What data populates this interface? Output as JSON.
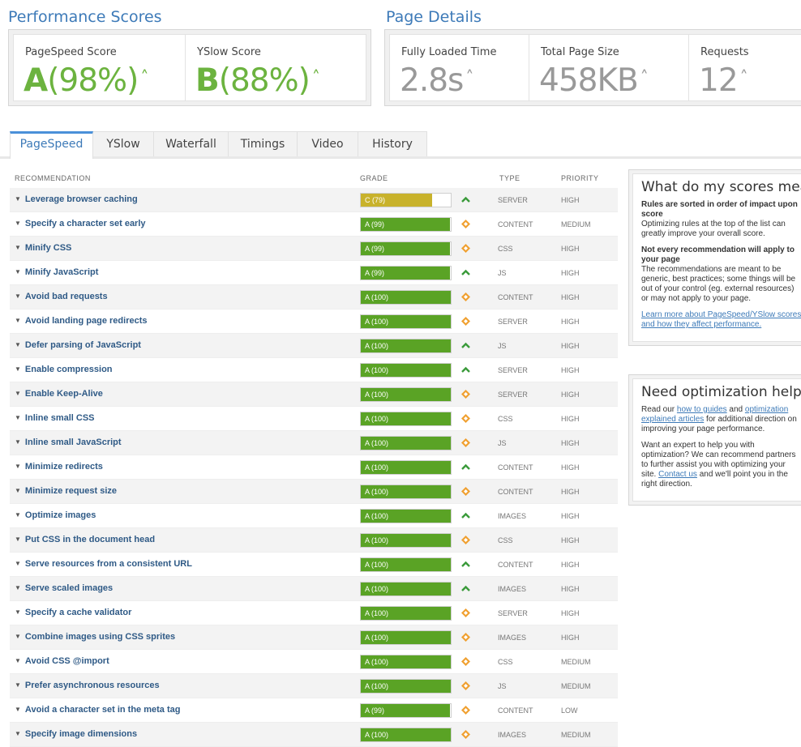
{
  "performance": {
    "title": "Performance Scores",
    "pagespeed": {
      "label": "PageSpeed Score",
      "grade": "A",
      "percent": "(98%)"
    },
    "yslow": {
      "label": "YSlow Score",
      "grade": "B",
      "percent": "(88%)"
    }
  },
  "details": {
    "title": "Page Details",
    "loaded": {
      "label": "Fully Loaded Time",
      "value": "2.8s"
    },
    "size": {
      "label": "Total Page Size",
      "value": "458KB"
    },
    "requests": {
      "label": "Requests",
      "value": "12"
    }
  },
  "tabs": [
    "PageSpeed",
    "YSlow",
    "Waterfall",
    "Timings",
    "Video",
    "History"
  ],
  "active_tab": "PageSpeed",
  "table": {
    "headers": {
      "recommendation": "RECOMMENDATION",
      "grade": "GRADE",
      "type": "TYPE",
      "priority": "PRIORITY"
    },
    "rows": [
      {
        "name": "Leverage browser caching",
        "grade": "C (79)",
        "score": 0.79,
        "color": "#c8b22b",
        "icon": "up-arrow-icon",
        "type": "SERVER",
        "priority": "HIGH"
      },
      {
        "name": "Specify a character set early",
        "grade": "A (99)",
        "score": 0.99,
        "color": "#5aa325",
        "icon": "diamond-icon",
        "type": "CONTENT",
        "priority": "MEDIUM"
      },
      {
        "name": "Minify CSS",
        "grade": "A (99)",
        "score": 0.99,
        "color": "#5aa325",
        "icon": "diamond-icon",
        "type": "CSS",
        "priority": "HIGH"
      },
      {
        "name": "Minify JavaScript",
        "grade": "A (99)",
        "score": 0.99,
        "color": "#5aa325",
        "icon": "up-arrow-icon",
        "type": "JS",
        "priority": "HIGH"
      },
      {
        "name": "Avoid bad requests",
        "grade": "A (100)",
        "score": 1.0,
        "color": "#5aa325",
        "icon": "diamond-icon",
        "type": "CONTENT",
        "priority": "HIGH"
      },
      {
        "name": "Avoid landing page redirects",
        "grade": "A (100)",
        "score": 1.0,
        "color": "#5aa325",
        "icon": "diamond-icon",
        "type": "SERVER",
        "priority": "HIGH"
      },
      {
        "name": "Defer parsing of JavaScript",
        "grade": "A (100)",
        "score": 1.0,
        "color": "#5aa325",
        "icon": "up-arrow-icon",
        "type": "JS",
        "priority": "HIGH"
      },
      {
        "name": "Enable compression",
        "grade": "A (100)",
        "score": 1.0,
        "color": "#5aa325",
        "icon": "up-arrow-icon",
        "type": "SERVER",
        "priority": "HIGH"
      },
      {
        "name": "Enable Keep-Alive",
        "grade": "A (100)",
        "score": 1.0,
        "color": "#5aa325",
        "icon": "diamond-icon",
        "type": "SERVER",
        "priority": "HIGH"
      },
      {
        "name": "Inline small CSS",
        "grade": "A (100)",
        "score": 1.0,
        "color": "#5aa325",
        "icon": "diamond-icon",
        "type": "CSS",
        "priority": "HIGH"
      },
      {
        "name": "Inline small JavaScript",
        "grade": "A (100)",
        "score": 1.0,
        "color": "#5aa325",
        "icon": "diamond-icon",
        "type": "JS",
        "priority": "HIGH"
      },
      {
        "name": "Minimize redirects",
        "grade": "A (100)",
        "score": 1.0,
        "color": "#5aa325",
        "icon": "up-arrow-icon",
        "type": "CONTENT",
        "priority": "HIGH"
      },
      {
        "name": "Minimize request size",
        "grade": "A (100)",
        "score": 1.0,
        "color": "#5aa325",
        "icon": "diamond-icon",
        "type": "CONTENT",
        "priority": "HIGH"
      },
      {
        "name": "Optimize images",
        "grade": "A (100)",
        "score": 1.0,
        "color": "#5aa325",
        "icon": "up-arrow-icon",
        "type": "IMAGES",
        "priority": "HIGH"
      },
      {
        "name": "Put CSS in the document head",
        "grade": "A (100)",
        "score": 1.0,
        "color": "#5aa325",
        "icon": "diamond-icon",
        "type": "CSS",
        "priority": "HIGH"
      },
      {
        "name": "Serve resources from a consistent URL",
        "grade": "A (100)",
        "score": 1.0,
        "color": "#5aa325",
        "icon": "up-arrow-icon",
        "type": "CONTENT",
        "priority": "HIGH"
      },
      {
        "name": "Serve scaled images",
        "grade": "A (100)",
        "score": 1.0,
        "color": "#5aa325",
        "icon": "up-arrow-icon",
        "type": "IMAGES",
        "priority": "HIGH"
      },
      {
        "name": "Specify a cache validator",
        "grade": "A (100)",
        "score": 1.0,
        "color": "#5aa325",
        "icon": "diamond-icon",
        "type": "SERVER",
        "priority": "HIGH"
      },
      {
        "name": "Combine images using CSS sprites",
        "grade": "A (100)",
        "score": 1.0,
        "color": "#5aa325",
        "icon": "diamond-icon",
        "type": "IMAGES",
        "priority": "HIGH"
      },
      {
        "name": "Avoid CSS @import",
        "grade": "A (100)",
        "score": 1.0,
        "color": "#5aa325",
        "icon": "diamond-icon",
        "type": "CSS",
        "priority": "MEDIUM"
      },
      {
        "name": "Prefer asynchronous resources",
        "grade": "A (100)",
        "score": 1.0,
        "color": "#5aa325",
        "icon": "diamond-icon",
        "type": "JS",
        "priority": "MEDIUM"
      },
      {
        "name": "Avoid a character set in the meta tag",
        "grade": "A (99)",
        "score": 0.99,
        "color": "#5aa325",
        "icon": "diamond-icon",
        "type": "CONTENT",
        "priority": "LOW"
      },
      {
        "name": "Specify image dimensions",
        "grade": "A (100)",
        "score": 1.0,
        "color": "#5aa325",
        "icon": "diamond-icon",
        "type": "IMAGES",
        "priority": "MEDIUM"
      }
    ]
  },
  "sidebar": {
    "scores": {
      "title": "What do my scores mean?",
      "h1": "Rules are sorted in order of impact upon score",
      "p1": "Optimizing rules at the top of the list can greatly improve your overall score.",
      "h2": "Not every recommendation will apply to your page",
      "p2": "The recommendations are meant to be generic, best practices; some things will be out of your control (eg. external resources) or may not apply to your page.",
      "link": "Learn more about PageSpeed/YSlow scores and how they affect performance."
    },
    "help": {
      "title": "Need optimization help?",
      "p1a": "Read our ",
      "link1": "how to guides",
      "p1b": " and ",
      "link2": "optimization explained articles",
      "p1c": " for additional direction on improving your page performance.",
      "p2a": "Want an expert to help you with optimization? We can recommend partners to further assist you with optimizing your site. ",
      "link3": "Contact us",
      "p2b": " and we'll point you in the right direction."
    }
  },
  "colors": {
    "accent": "#3d7ab8",
    "grade_green": "#5aa325",
    "grade_yellow": "#c8b22b",
    "up_arrow": "#3a9a3a",
    "diamond": "#f0a030"
  }
}
